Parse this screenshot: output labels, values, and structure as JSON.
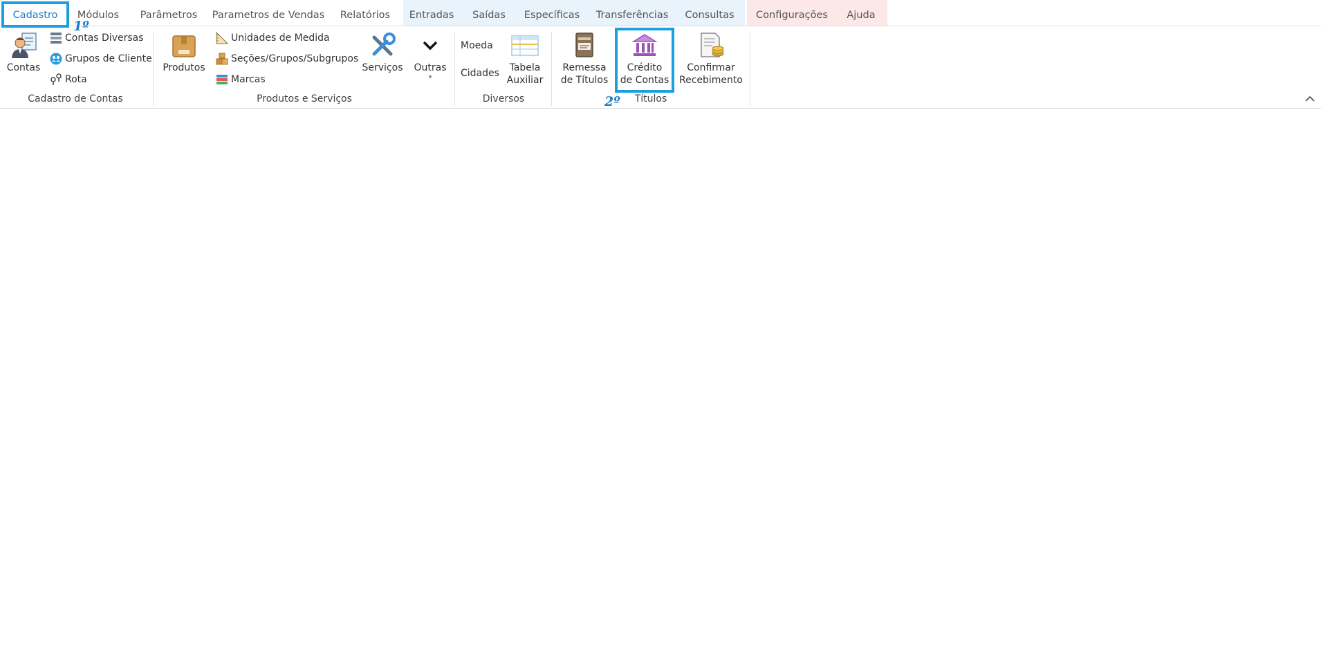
{
  "tabs": [
    {
      "label": "Cadastro",
      "active": true
    },
    {
      "label": "Módulos"
    },
    {
      "label": "Parâmetros"
    },
    {
      "label": "Parametros de Vendas"
    },
    {
      "label": "Relatórios"
    },
    {
      "label": "Entradas"
    },
    {
      "label": "Saídas"
    },
    {
      "label": "Específicas"
    },
    {
      "label": "Transferências"
    },
    {
      "label": "Consultas"
    },
    {
      "label": "Configurações"
    },
    {
      "label": "Ajuda"
    }
  ],
  "annotations": {
    "step1": "1º",
    "step2": "2º"
  },
  "groups": {
    "cadastro_contas": {
      "label": "Cadastro de Contas",
      "contas": "Contas",
      "contas_diversas": "Contas Diversas",
      "grupos_cliente": "Grupos de Cliente",
      "rota": "Rota"
    },
    "produtos_servicos": {
      "label": "Produtos e Serviços",
      "produtos": "Produtos",
      "unidades": "Unidades de Medida",
      "secoes": "Seções/Grupos/Subgrupos",
      "marcas": "Marcas",
      "servicos": "Serviços",
      "outras": "Outras"
    },
    "diversos": {
      "label": "Diversos",
      "moeda": "Moeda",
      "cidades": "Cidades",
      "tabela_l1": "Tabela",
      "tabela_l2": "Auxiliar"
    },
    "titulos": {
      "label": "Títulos",
      "remessa_l1": "Remessa",
      "remessa_l2": "de Títulos",
      "credito_l1": "Crédito",
      "credito_l2": "de Contas",
      "confirmar_l1": "Confirmar",
      "confirmar_l2": "Recebimento"
    }
  },
  "icons": {
    "contas": "person-card-icon",
    "contas_diversas": "list-icon",
    "grupos_cliente": "group-icon",
    "rota": "route-pin-icon",
    "produtos": "box-icon",
    "unidades": "ruler-icon",
    "secoes": "boxes-icon",
    "marcas": "tags-icon",
    "servicos": "tools-icon",
    "outras": "chevron-down-icon",
    "tabela": "table-icon",
    "remessa": "printer-icon",
    "credito": "bank-icon",
    "confirmar": "receipt-coins-icon",
    "collapse": "chevron-up-icon"
  },
  "colors": {
    "accent": "#1a7dc8",
    "highlight": "#1aa0e0",
    "context_blue": "#e8f3fb",
    "context_red": "#fde8e8",
    "bank_icon": "#9b4fb8"
  }
}
